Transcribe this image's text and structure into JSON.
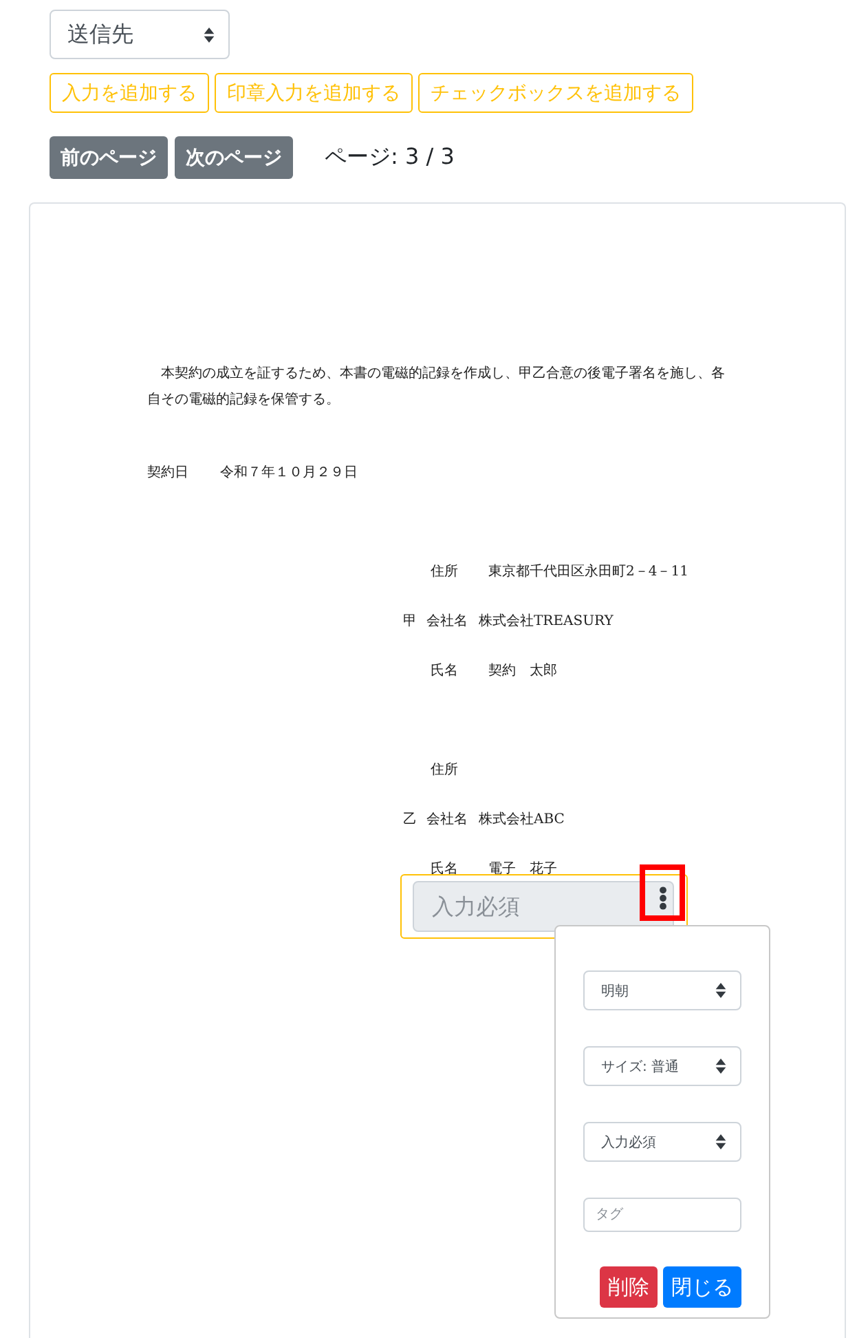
{
  "recipient_select": {
    "value": "送信先"
  },
  "add_buttons": [
    "入力を追加する",
    "印章入力を追加する",
    "チェックボックスを追加する"
  ],
  "pager": {
    "buttons": [
      "前のページ",
      "次のページ"
    ],
    "label": "ページ: 3 / 3"
  },
  "document": {
    "paragraph": "本契約の成立を証するため、本書の電磁的記録を作成し、甲乙合意の後電子署名を施し、各自その電磁的記録を保管する。",
    "date": {
      "label": "契約日",
      "value": "令和７年１０月２９日"
    },
    "parties": [
      {
        "mark": "甲",
        "address": {
          "label": "住所",
          "value": "東京都千代田区永田町2－4－11"
        },
        "company": {
          "label": "会社名",
          "value": "株式会社TREASURY"
        },
        "name": {
          "label": "氏名",
          "value": "契約　太郎"
        }
      },
      {
        "mark": "乙",
        "address": {
          "label": "住所"
        },
        "company": {
          "label": "会社名",
          "value": "株式会社ABC"
        },
        "name": {
          "label": "氏名",
          "value": "電子　花子"
        }
      }
    ]
  },
  "field": {
    "placeholder": "入力必須",
    "menu_highlighted": true
  },
  "field_settings": {
    "selects": [
      "明朝",
      "サイズ: 普通",
      "入力必須"
    ],
    "tag": {
      "placeholder": "タグ"
    },
    "buttons": [
      {
        "label": "削除",
        "kind": "danger"
      },
      {
        "label": "閉じる",
        "kind": "primary"
      }
    ]
  }
}
